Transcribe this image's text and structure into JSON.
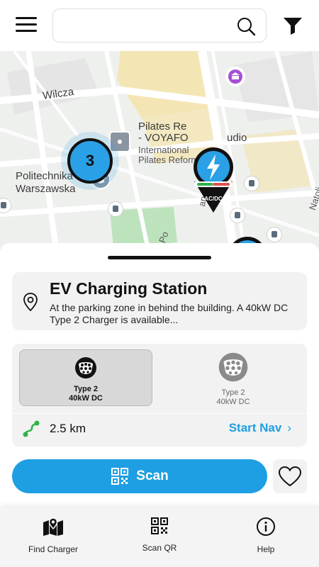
{
  "header": {
    "search_placeholder": "",
    "menu_icon": "hamburger-menu-icon",
    "search_icon": "search-icon",
    "filter_icon": "filter-funnel-icon"
  },
  "map": {
    "labels": {
      "wilcza": "Wilcza",
      "pilates_1": "Pilates Re",
      "pilates_1b": "udio",
      "pilates_2": "- VOYAFO",
      "international_1": "International",
      "international_2": "Pilates Reformer",
      "politechnika_1": "Politechnika",
      "politechnika_2": "Warszawska",
      "marynskiego": "aryńskiego",
      "natolin": "Natoli",
      "po": "Po"
    },
    "cluster_count": "3",
    "charger_badge": "AC/DC",
    "colors": {
      "pin": "#2aa0e6",
      "accent": "#1f9fe3"
    }
  },
  "station": {
    "title": "EV Charging Station",
    "description": "At the parking zone in behind the building. A 40kW DC Type 2 Charger is available..."
  },
  "connectors": [
    {
      "type": "Type 2",
      "power": "40kW DC",
      "selected": true
    },
    {
      "type": "Type 2",
      "power": "40kW DC",
      "selected": false
    }
  ],
  "route": {
    "distance": "2.5 km",
    "start_nav_label": "Start Nav",
    "chevron": "›"
  },
  "actions": {
    "scan_label": "Scan"
  },
  "bottom_nav": {
    "items": [
      {
        "label": "Find Charger",
        "icon": "map-marker-icon"
      },
      {
        "label": "Scan QR",
        "icon": "qr-code-icon"
      },
      {
        "label": "Help",
        "icon": "info-icon"
      }
    ]
  }
}
